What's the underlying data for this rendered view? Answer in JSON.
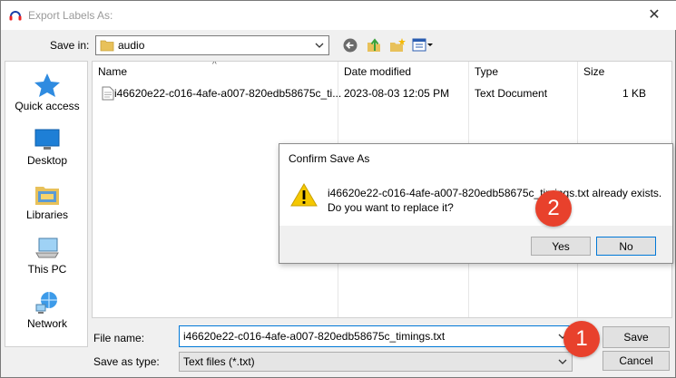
{
  "window": {
    "title": "Export Labels As:"
  },
  "save_in": {
    "label": "Save in:",
    "value": "audio"
  },
  "toolbar": {
    "icons": [
      "back-icon",
      "up-folder-icon",
      "new-folder-icon",
      "view-menu-icon"
    ]
  },
  "places": [
    {
      "label": "Quick access",
      "icon": "star-icon"
    },
    {
      "label": "Desktop",
      "icon": "desktop-icon"
    },
    {
      "label": "Libraries",
      "icon": "libraries-icon"
    },
    {
      "label": "This PC",
      "icon": "computer-icon"
    },
    {
      "label": "Network",
      "icon": "network-icon"
    }
  ],
  "file_list": {
    "columns": [
      "Name",
      "Date modified",
      "Type",
      "Size"
    ],
    "rows": [
      {
        "name": "i46620e22-c016-4afe-a007-820edb58675c_ti...",
        "date": "2023-08-03 12:05 PM",
        "type": "Text Document",
        "size": "1 KB"
      }
    ]
  },
  "file_name": {
    "label": "File name:",
    "value": "i46620e22-c016-4afe-a007-820edb58675c_timings.txt"
  },
  "save_as_type": {
    "label": "Save as type:",
    "value": "Text files (*.txt)"
  },
  "buttons": {
    "save": "Save",
    "cancel": "Cancel"
  },
  "confirm": {
    "title": "Confirm Save As",
    "line1": "i46620e22-c016-4afe-a007-820edb58675c_timings.txt already exists.",
    "line2": "Do you want to replace it?",
    "yes": "Yes",
    "no": "No"
  },
  "steps": [
    "1",
    "2"
  ],
  "colors": {
    "step_badge": "#e8412c",
    "focus_border": "#0078d7",
    "folder": "#e8c15a"
  }
}
